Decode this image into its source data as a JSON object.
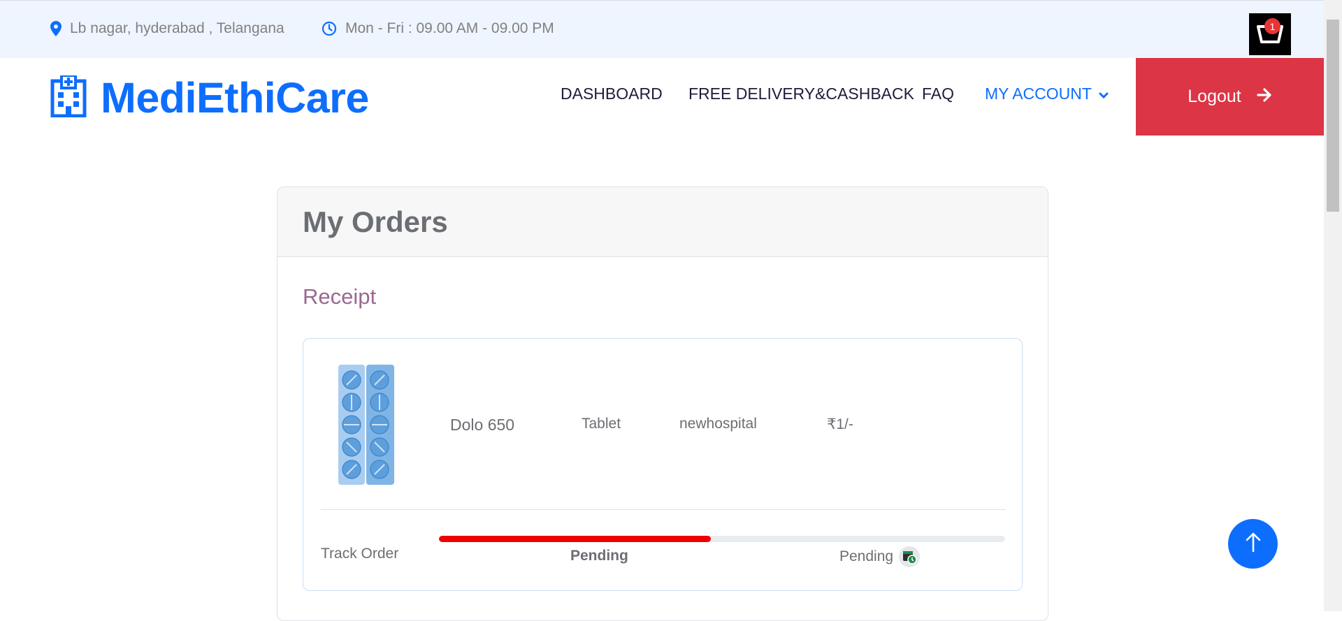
{
  "topbar": {
    "location": "Lb nagar, hyderabad , Telangana",
    "hours": "Mon - Fri : 09.00 AM - 09.00 PM",
    "cart_count": "1"
  },
  "navbar": {
    "brand": "MediEthiCare",
    "items": [
      {
        "label": "DASHBOARD"
      },
      {
        "label": "FREE DELIVERY&CASHBACK"
      },
      {
        "label": "FAQ"
      },
      {
        "label": "MY ACCOUNT"
      }
    ],
    "logout_label": "Logout"
  },
  "orders": {
    "title": "My Orders",
    "receipt_label": "Receipt",
    "item": {
      "name": "Dolo 650",
      "type": "Tablet",
      "hospital": "newhospital",
      "price": "₹1/-"
    },
    "tracking": {
      "label": "Track Order",
      "progress": 0.48,
      "status_center": "Pending",
      "status_right": "Pending"
    }
  },
  "colors": {
    "brand": "#0d6efd",
    "logout": "#dc3545",
    "progress": "#ee0000",
    "receipt": "#9b6890"
  }
}
